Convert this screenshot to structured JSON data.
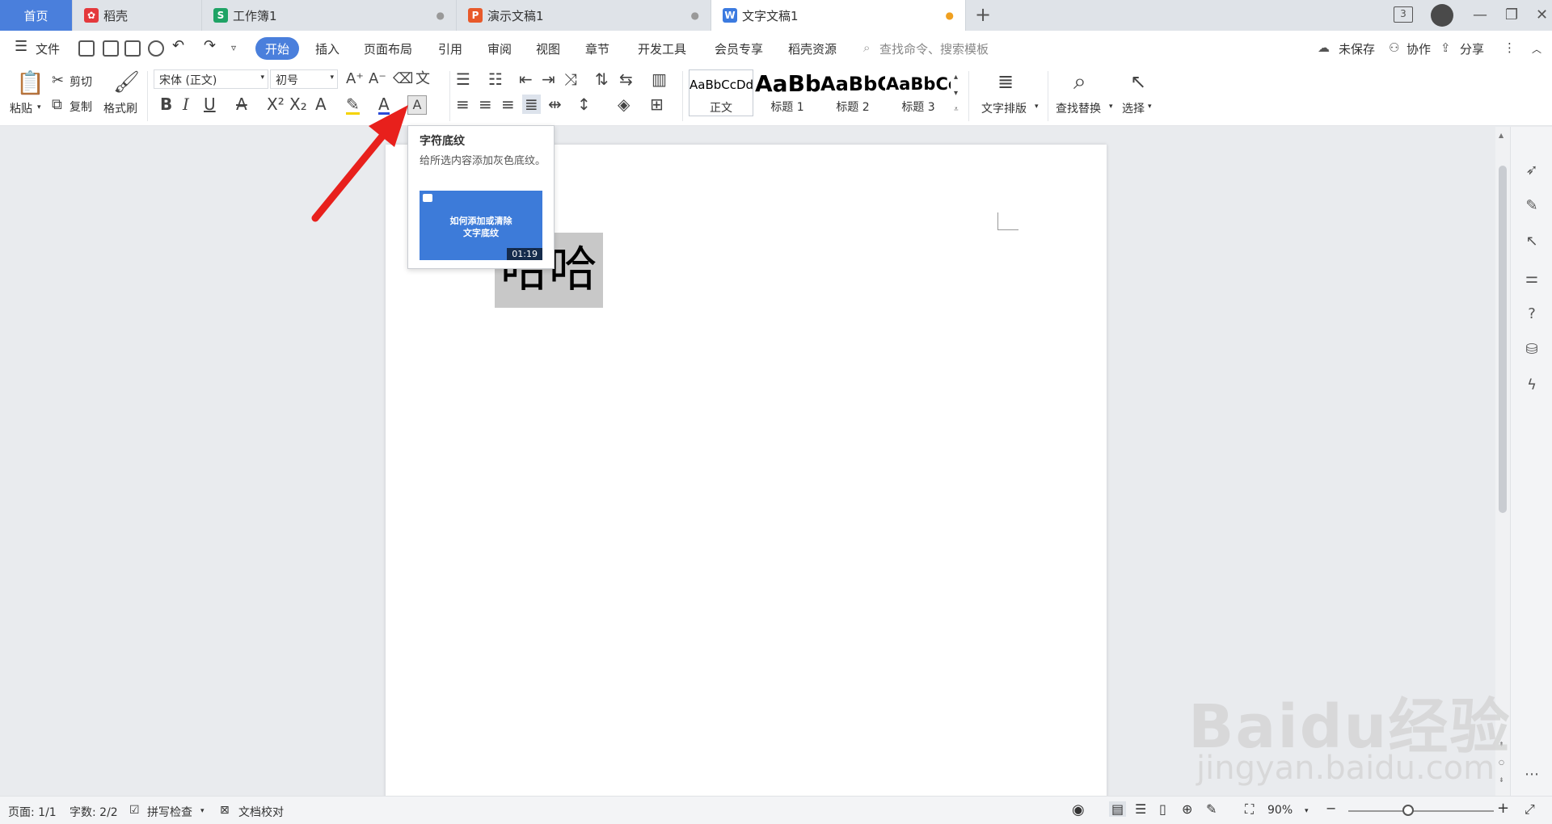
{
  "tabs": {
    "home": "首页",
    "daoke": "稻壳",
    "workbook": "工作簿1",
    "presentation": "演示文稿1",
    "document": "文字文稿1",
    "new_tab_symbol": "+",
    "window_count": "3"
  },
  "menu": {
    "file": "文件",
    "items": [
      "开始",
      "插入",
      "页面布局",
      "引用",
      "审阅",
      "视图",
      "章节",
      "开发工具",
      "会员专享",
      "稻壳资源"
    ],
    "search_placeholder": "查找命令、搜索模板",
    "unsaved": "未保存",
    "collaborate": "协作",
    "share": "分享"
  },
  "ribbon": {
    "paste": "粘贴",
    "cut": "剪切",
    "copy": "复制",
    "format_painter": "格式刷",
    "font_name": "宋体 (正文)",
    "font_size": "初号",
    "styles": [
      {
        "sample": "AaBbCcDd",
        "name": "正文"
      },
      {
        "sample": "AaBb",
        "name": "标题 1"
      },
      {
        "sample": "AaBbC",
        "name": "标题 2"
      },
      {
        "sample": "AaBbCc",
        "name": "标题 3"
      }
    ],
    "text_layout": "文字排版",
    "find_replace": "查找替换",
    "select": "选择"
  },
  "tooltip": {
    "title": "字符底纹",
    "description": "给所选内容添加灰色底纹。",
    "video_title_line1": "如何添加或清除",
    "video_title_line2": "文字底纹",
    "duration": "01:19"
  },
  "document": {
    "content": "哈哈"
  },
  "status": {
    "page": "页面: 1/1",
    "word_count": "字数: 2/2",
    "spell_check": "拼写检查",
    "doc_proof": "文档校对",
    "zoom": "90%",
    "zoom_level_percent": 90
  },
  "watermark": {
    "brand": "Baidu经验",
    "url": "jingyan.baidu.com"
  },
  "colors": {
    "accent": "#4a7fdc",
    "arrow": "#e8201c",
    "char_shading": "#c8c8c8"
  }
}
